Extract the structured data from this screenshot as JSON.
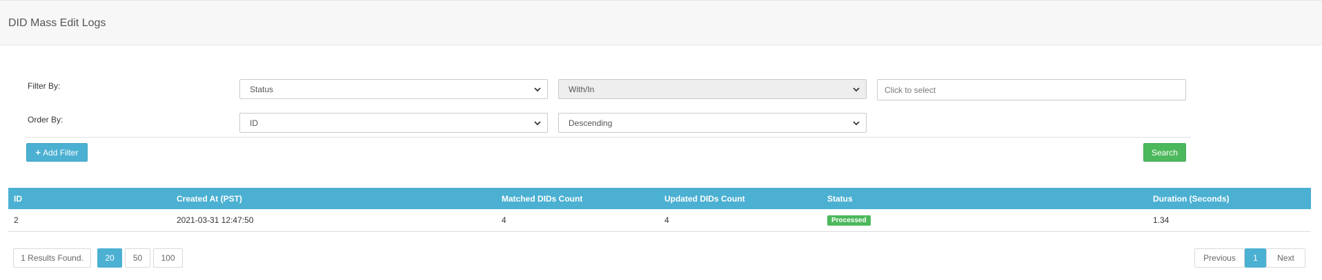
{
  "page": {
    "title": "DID Mass Edit Logs"
  },
  "filters": {
    "filter_by_label": "Filter By:",
    "order_by_label": "Order By:",
    "filter_field": "Status",
    "filter_operator": "With/In",
    "filter_value_placeholder": "Click to select",
    "order_field": "ID",
    "order_direction": "Descending",
    "add_filter_label": "Add Filter",
    "search_label": "Search"
  },
  "table": {
    "columns": [
      "ID",
      "Created At (PST)",
      "Matched DIDs Count",
      "Updated DIDs Count",
      "Status",
      "Duration (Seconds)"
    ],
    "rows": [
      {
        "id": "2",
        "created_at": "2021-03-31 12:47:50",
        "matched": "4",
        "updated": "4",
        "status": "Processed",
        "duration": "1.34"
      }
    ]
  },
  "pagination": {
    "results_text": "1 Results Found.",
    "page_sizes": [
      "20",
      "50",
      "100"
    ],
    "selected_page_size": "20",
    "previous_label": "Previous",
    "current_page": "1",
    "next_label": "Next"
  },
  "colors": {
    "accent": "#4bb0d2",
    "success": "#4cb85c"
  }
}
